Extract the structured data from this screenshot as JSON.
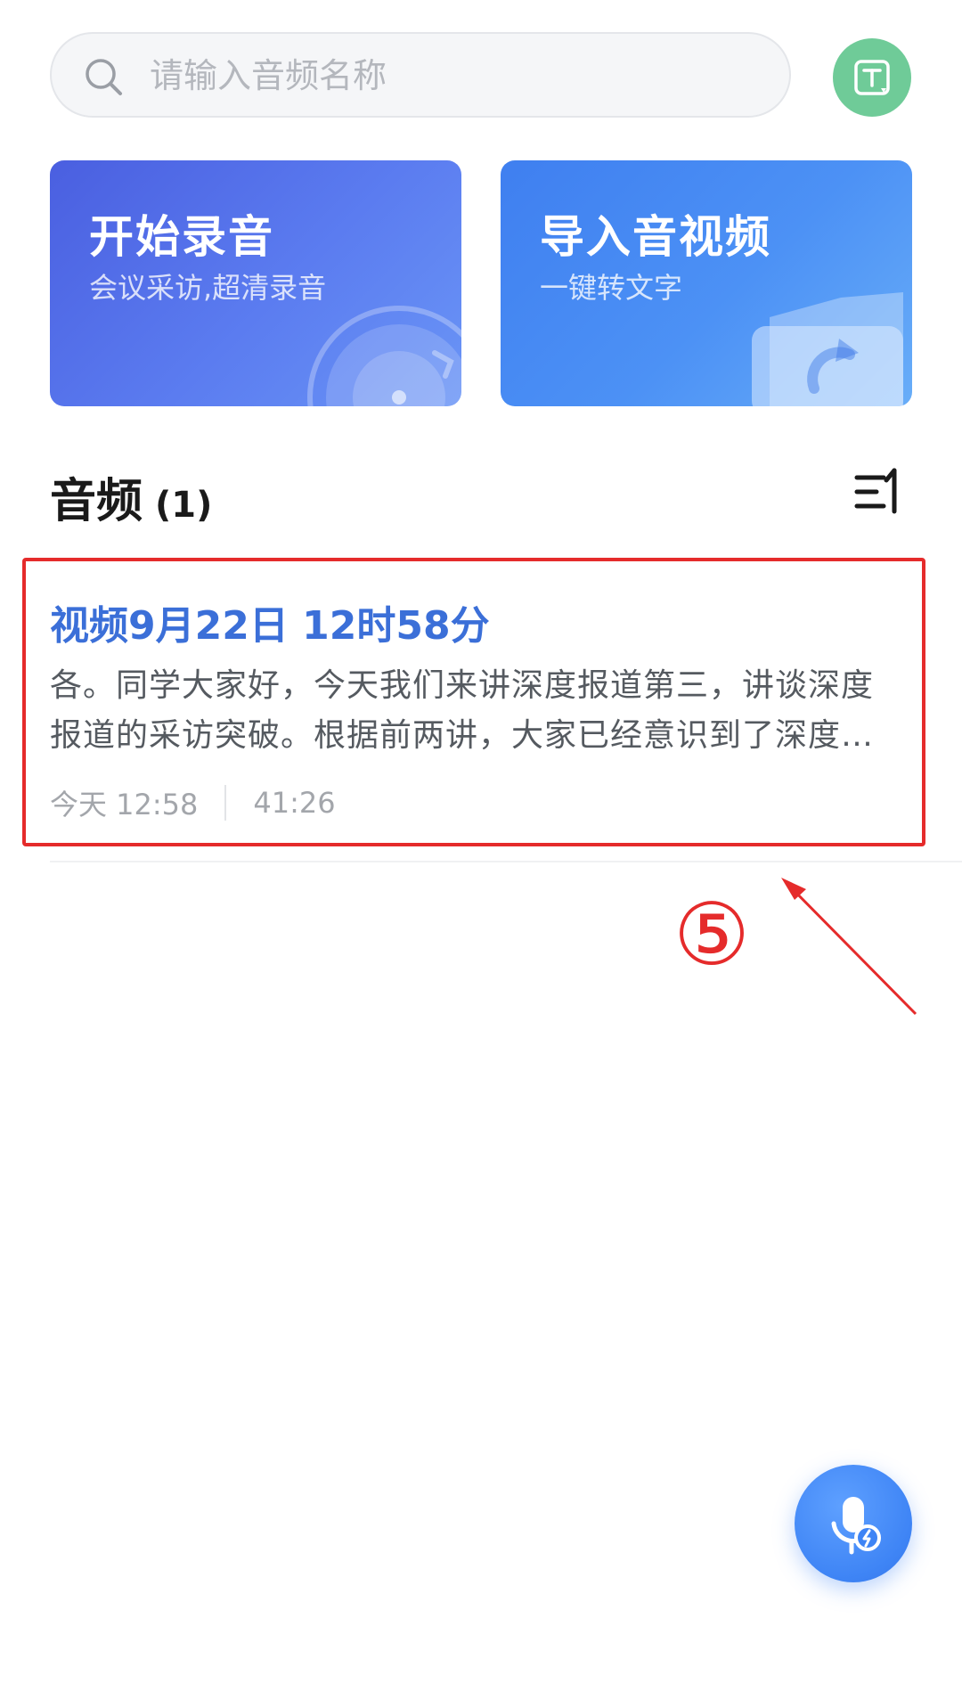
{
  "search": {
    "placeholder": "请输入音频名称",
    "value": ""
  },
  "header": {
    "transcribe_icon": "text-transcribe-icon"
  },
  "actions": {
    "record": {
      "title": "开始录音",
      "subtitle": "会议采访,超清录音",
      "icon": "vinyl-disc-icon"
    },
    "import": {
      "title": "导入音视频",
      "subtitle": "一键转文字",
      "icon": "folder-upload-icon"
    }
  },
  "section": {
    "title": "音频",
    "count": "(1)",
    "sort_icon": "sort-icon"
  },
  "audio_list": [
    {
      "title": "视频9月22日 12时58分",
      "preview_line1": "各。同学大家好，今天我们来讲深度报道第三，讲谈深度",
      "preview_line2": "报道的采访突破。根据前两讲，大家已经意识到了深度…",
      "date": "今天 12:58",
      "duration": "41:26"
    }
  ],
  "annotation": {
    "number": "⑤",
    "color": "#e52b2b"
  },
  "fab": {
    "icon": "microphone-icon"
  },
  "colors": {
    "accent": "#3b6fd8",
    "record_card": "#4a5fe0",
    "import_card": "#3f7ff0",
    "transcribe_button": "#6fcb98"
  }
}
